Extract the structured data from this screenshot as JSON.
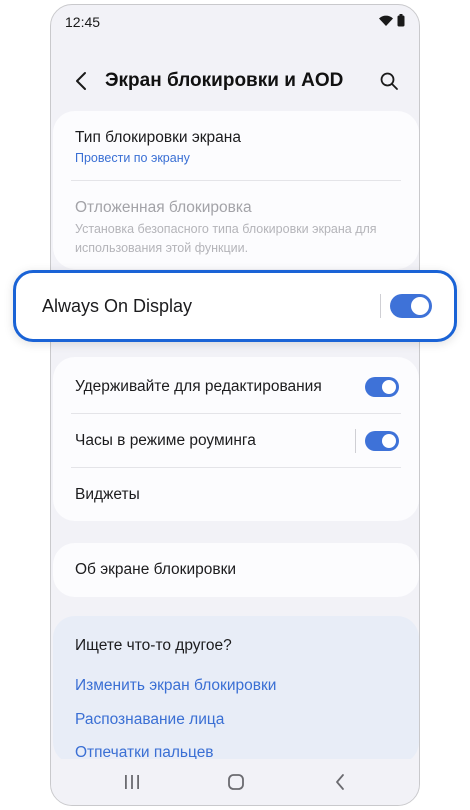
{
  "status_bar": {
    "time": "12:45",
    "icons": [
      "wifi-icon",
      "battery-icon"
    ]
  },
  "header": {
    "title": "Экран блокировки и AOD",
    "back_icon": "chevron-left-icon",
    "search_icon": "search-icon"
  },
  "lock_section": {
    "lock_type": {
      "title": "Тип блокировки экрана",
      "value": "Провести по экрану"
    },
    "delayed_lock": {
      "title": "Отложенная блокировка",
      "description_line1": "Установка безопасного типа блокировки экрана для",
      "description_line2": "использования этой функции."
    }
  },
  "aod": {
    "label": "Always On Display",
    "enabled": true
  },
  "misc_section": {
    "hold_to_edit": {
      "label": "Удерживайте для редактирования",
      "enabled": true
    },
    "roaming_clock": {
      "label": "Часы в режиме роуминга",
      "enabled": true
    },
    "widgets": {
      "label": "Виджеты"
    }
  },
  "about": {
    "label": "Об экране блокировки"
  },
  "related": {
    "title": "Ищете что-то другое?",
    "links": [
      "Изменить экран блокировки",
      "Распознавание лица",
      "Отпечатки пальцев"
    ]
  },
  "colors": {
    "accent": "#3e72d8",
    "highlight_border": "#1a63d6",
    "link": "#3a6fd4"
  }
}
